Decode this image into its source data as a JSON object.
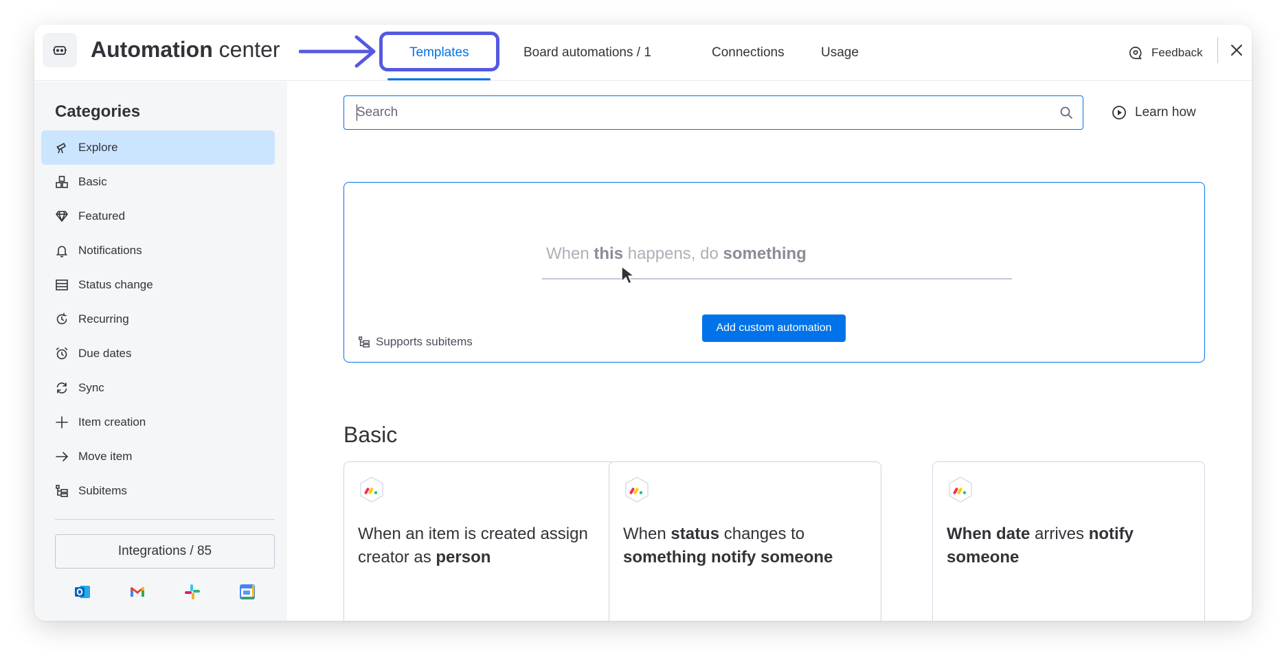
{
  "header": {
    "title_bold": "Automation",
    "title_rest": " center",
    "tabs": [
      {
        "label": "Templates",
        "active": true
      },
      {
        "label": "Board automations / 1",
        "active": false
      },
      {
        "label": "Connections",
        "active": false
      },
      {
        "label": "Usage",
        "active": false
      }
    ],
    "feedback_label": "Feedback"
  },
  "sidebar": {
    "title": "Categories",
    "items": [
      {
        "label": "Explore",
        "icon": "telescope-icon",
        "active": true
      },
      {
        "label": "Basic",
        "icon": "basic-blocks-icon",
        "active": false
      },
      {
        "label": "Featured",
        "icon": "diamond-icon",
        "active": false
      },
      {
        "label": "Notifications",
        "icon": "bell-icon",
        "active": false
      },
      {
        "label": "Status change",
        "icon": "status-table-icon",
        "active": false
      },
      {
        "label": "Recurring",
        "icon": "recurring-icon",
        "active": false
      },
      {
        "label": "Due dates",
        "icon": "alarm-clock-icon",
        "active": false
      },
      {
        "label": "Sync",
        "icon": "sync-icon",
        "active": false
      },
      {
        "label": "Item creation",
        "icon": "plus-icon",
        "active": false
      },
      {
        "label": "Move item",
        "icon": "arrow-right-icon",
        "active": false
      },
      {
        "label": "Subitems",
        "icon": "subitems-icon",
        "active": false
      }
    ],
    "integrations_label": "Integrations / 85",
    "integration_apps": [
      "outlook-icon",
      "gmail-icon",
      "slack-icon",
      "google-calendar-icon"
    ]
  },
  "main": {
    "search_placeholder": "Search",
    "learn_how_label": "Learn how",
    "custom": {
      "w1": "When ",
      "w2": "this",
      "w3": " happens,  do ",
      "w4": "something",
      "button_label": "Add custom automation",
      "supports_label": "Supports subitems"
    },
    "basic_title": "Basic",
    "cards": [
      {
        "parts": [
          [
            "When an item is created assign creator as ",
            false
          ],
          [
            "person",
            true
          ]
        ]
      },
      {
        "parts": [
          [
            "When ",
            false
          ],
          [
            "status",
            true
          ],
          [
            " changes to ",
            false
          ],
          [
            "something notify someone",
            true
          ]
        ]
      },
      {
        "parts": [
          [
            "When date",
            true
          ],
          [
            " arrives ",
            false
          ],
          [
            "notify someone",
            true
          ]
        ]
      }
    ]
  },
  "colors": {
    "accent": "#0073ea",
    "highlight": "#5559df",
    "sidebar_bg": "#f5f6f8",
    "active_item_bg": "#cce5ff"
  }
}
